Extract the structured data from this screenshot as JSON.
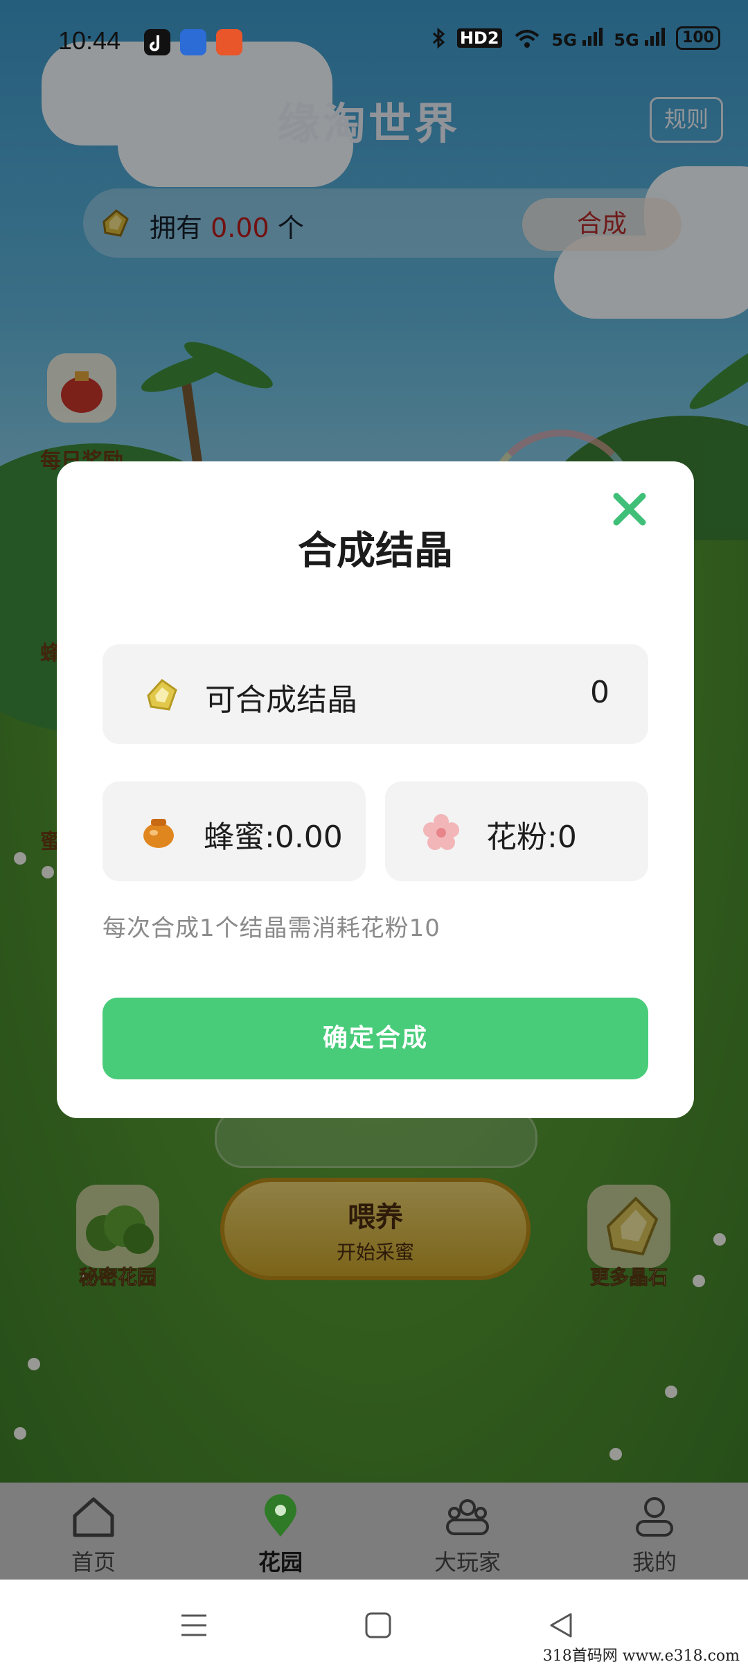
{
  "status_bar": {
    "time": "10:44",
    "network": "5G",
    "network2": "5G",
    "hd": "HD2",
    "battery": "100"
  },
  "header": {
    "title": "缘淘世界",
    "rules_label": "规则",
    "own_prefix": "拥有",
    "own_value": "0.00",
    "own_suffix": "个",
    "merge_label": "合成"
  },
  "side_buttons": [
    {
      "label": "每日奖励",
      "icon": "gift-bag-icon"
    },
    {
      "label": "蜂",
      "icon": "bee-icon"
    },
    {
      "label": "蜜",
      "icon": "honey-icon"
    }
  ],
  "bottom_actions": {
    "left_label": "秘密花园",
    "feed_title": "喂养",
    "feed_sub": "开始采蜜",
    "right_label": "更多晶石"
  },
  "modal": {
    "title": "合成结晶",
    "crystal_label": "可合成结晶",
    "crystal_value": "0",
    "honey_label": "蜂蜜:0.00",
    "pollen_label": "花粉:0",
    "note": "每次合成1个结晶需消耗花粉10",
    "confirm_label": "确定合成"
  },
  "tabs": [
    {
      "label": "首页",
      "icon": "home-icon",
      "active": false
    },
    {
      "label": "花园",
      "icon": "garden-location-icon",
      "active": true
    },
    {
      "label": "大玩家",
      "icon": "players-icon",
      "active": false
    },
    {
      "label": "我的",
      "icon": "profile-icon",
      "active": false
    }
  ],
  "watermark": "318首码网  www.e318.com",
  "colors": {
    "accent_green": "#48cc79",
    "value_red": "#b81c1c",
    "close_green": "#3fbf78"
  }
}
